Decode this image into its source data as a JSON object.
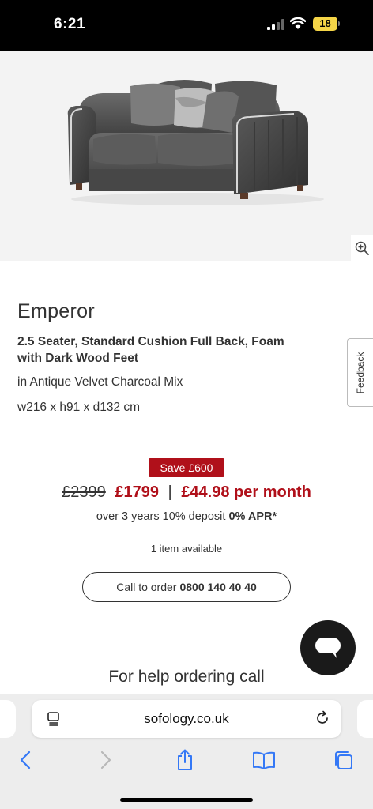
{
  "status_bar": {
    "time": "6:21",
    "battery": "18"
  },
  "product": {
    "name": "Emperor",
    "spec": "2.5 Seater, Standard Cushion Full Back, Foam with Dark Wood Feet",
    "fabric": "in Antique Velvet Charcoal Mix",
    "dimensions": "w216 x h91 x d132 cm"
  },
  "pricing": {
    "save_badge": "Save £600",
    "was_price": "£2399",
    "now_price": "£1799",
    "separator": "|",
    "monthly": "£44.98 per month",
    "finance_prefix": "over 3 years 10% deposit",
    "finance_apr": "0% APR*",
    "availability": "1 item available"
  },
  "call": {
    "label": "Call to order",
    "number": "0800 140 40 40"
  },
  "feedback_label": "Feedback",
  "help_text": "For help ordering call",
  "browser": {
    "url": "sofology.co.uk"
  },
  "colors": {
    "accent_red": "#b0101a",
    "status_bar": "#000000",
    "battery": "#f5d547"
  },
  "icons": {
    "zoom": "zoom-in-icon",
    "chat": "chat-bubble-icon",
    "reader": "reader-mode-icon",
    "reload": "reload-icon",
    "back": "chevron-left-icon",
    "forward": "chevron-right-icon",
    "share": "share-icon",
    "bookmarks": "book-icon",
    "tabs": "tabs-icon"
  }
}
